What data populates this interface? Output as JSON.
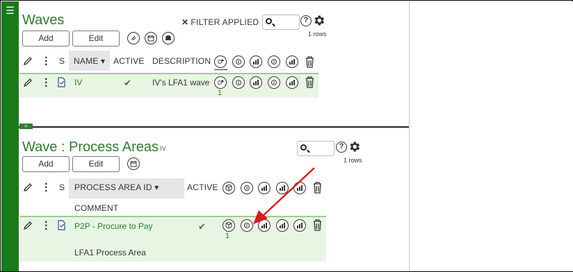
{
  "sidebar": {
    "menu_icon": "☰"
  },
  "waves": {
    "title": "Waves",
    "filter_label": "FILTER APPLIED",
    "filter_close": "✕",
    "rows_count": "1 rows",
    "add_label": "Add",
    "edit_label": "Edit",
    "columns": {
      "s": "S",
      "name": "NAME ▾",
      "active": "ACTIVE",
      "description": "DESCRIPTION"
    },
    "row": {
      "name": "IV",
      "active": "✔",
      "description": "IV's LFA1 wave",
      "count": "1"
    }
  },
  "process_areas": {
    "title": "Wave : Process Areas",
    "subtitle": "IV",
    "rows_count": "1 rows",
    "add_label": "Add",
    "edit_label": "Edit",
    "columns": {
      "s": "S",
      "id": "PROCESS AREA ID ▾",
      "active": "ACTIVE",
      "comment": "COMMENT"
    },
    "row": {
      "id": "P2P - Procure to Pay",
      "active": "✔",
      "comment": "LFA1 Process Area",
      "count": "1"
    }
  },
  "handle_label": "=",
  "help_label": "?",
  "colors": {
    "green": "#2e7d32",
    "row_bg": "#e8f5e3",
    "arrow": "#e01b1b"
  }
}
